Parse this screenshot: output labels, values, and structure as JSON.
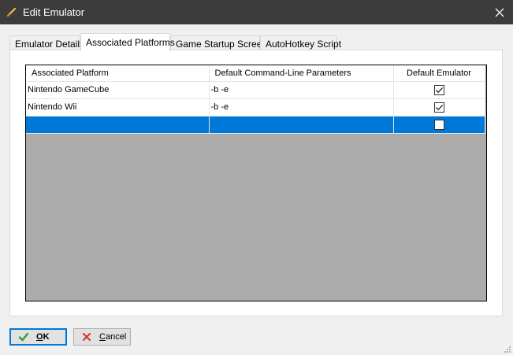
{
  "window": {
    "title": "Edit Emulator"
  },
  "tabs": [
    {
      "label": "Emulator Details"
    },
    {
      "label": "Associated Platforms"
    },
    {
      "label": "Game Startup Screen"
    },
    {
      "label": "AutoHotkey Script"
    }
  ],
  "grid": {
    "columns": [
      "Associated Platform",
      "Default Command-Line Parameters",
      "Default Emulator"
    ],
    "rows": [
      {
        "platform": "Nintendo GameCube",
        "params": "-b -e",
        "default": true
      },
      {
        "platform": "Nintendo Wii",
        "params": "-b -e",
        "default": true
      },
      {
        "platform": "",
        "params": "",
        "default": false
      }
    ]
  },
  "buttons": {
    "ok_label_mnemonic": "O",
    "ok_label_rest": "K",
    "cancel_label_mnemonic": "C",
    "cancel_label_rest": "ancel"
  },
  "colors": {
    "titlebar": "#3c3c3c",
    "selection": "#0078d7",
    "grid_empty": "#ababab",
    "ok_icon": "#2e9e3a",
    "cancel_icon": "#d33b2f"
  },
  "icons": {
    "app": "pencil-icon",
    "close": "close-icon",
    "ok": "check-icon",
    "cancel": "x-icon"
  }
}
